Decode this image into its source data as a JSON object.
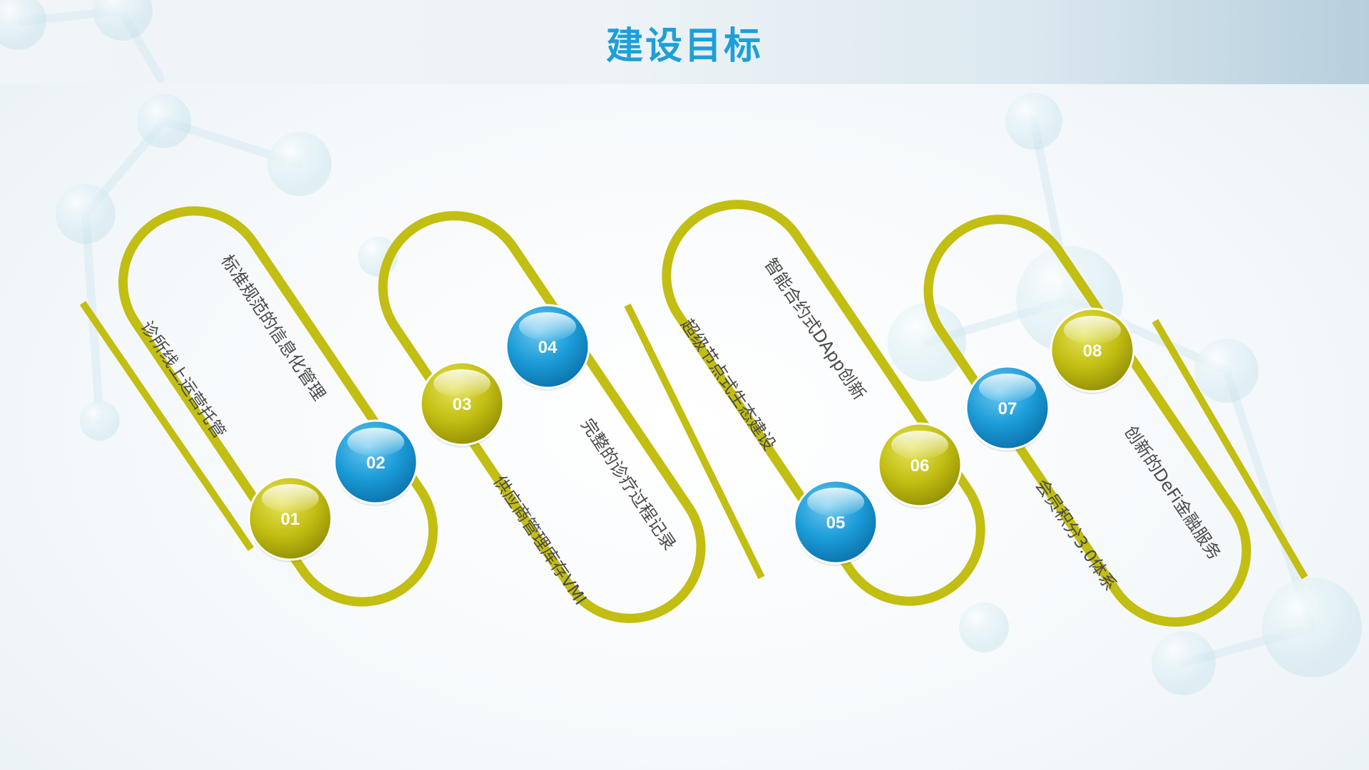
{
  "title": "建设目标",
  "colors": {
    "olive": "#c2be12",
    "blue": "#1a9bd7",
    "title": "#1e9fd8",
    "text": "#4a4a4a"
  },
  "steps": [
    {
      "num": "01",
      "label": "诊所线上运营托管",
      "color": "olive"
    },
    {
      "num": "02",
      "label": "标准规范的信息化管理",
      "color": "blue"
    },
    {
      "num": "03",
      "label": "供应商管理库存VMI",
      "color": "olive"
    },
    {
      "num": "04",
      "label": "完整的诊疗过程记录",
      "color": "blue"
    },
    {
      "num": "05",
      "label": "超级节点式生态建设",
      "color": "blue"
    },
    {
      "num": "06",
      "label": "智能合约式DApp创新",
      "color": "olive"
    },
    {
      "num": "07",
      "label": "会员积分3.0体系",
      "color": "blue"
    },
    {
      "num": "08",
      "label": "创新的DeFi金融服务",
      "color": "olive"
    }
  ]
}
